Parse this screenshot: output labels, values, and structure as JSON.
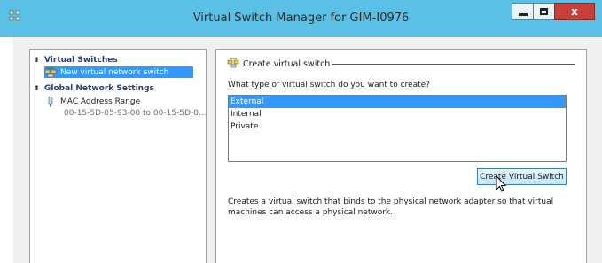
{
  "window": {
    "title": "Virtual Switch Manager for GIM-I0976",
    "controls": [
      "minimize",
      "maximize",
      "close"
    ],
    "close_glyph": "x"
  },
  "tree": {
    "virtual_switches": {
      "label": "Virtual Switches",
      "items": [
        {
          "label": "New virtual network switch",
          "selected": true,
          "icon": "network-switch-icon"
        }
      ]
    },
    "global_settings": {
      "label": "Global Network Settings",
      "items": [
        {
          "label": "MAC Address Range",
          "sub": "00-15-5D-05-93-00 to 00-15-5D-0...",
          "icon": "mac-address-icon"
        }
      ]
    }
  },
  "main": {
    "section_title": "Create virtual switch",
    "question": "What type of virtual switch do you want to create?",
    "switch_types": [
      "External",
      "Internal",
      "Private"
    ],
    "selected_type": "External",
    "create_button": "Create Virtual Switch",
    "description": "Creates a virtual switch that binds to the physical network adapter so that virtual machines can access a physical network."
  },
  "colors": {
    "titlebar": "#5bc0e6",
    "selection": "#3399ff",
    "close": "#c7403a",
    "category": "#1f3d7a"
  }
}
